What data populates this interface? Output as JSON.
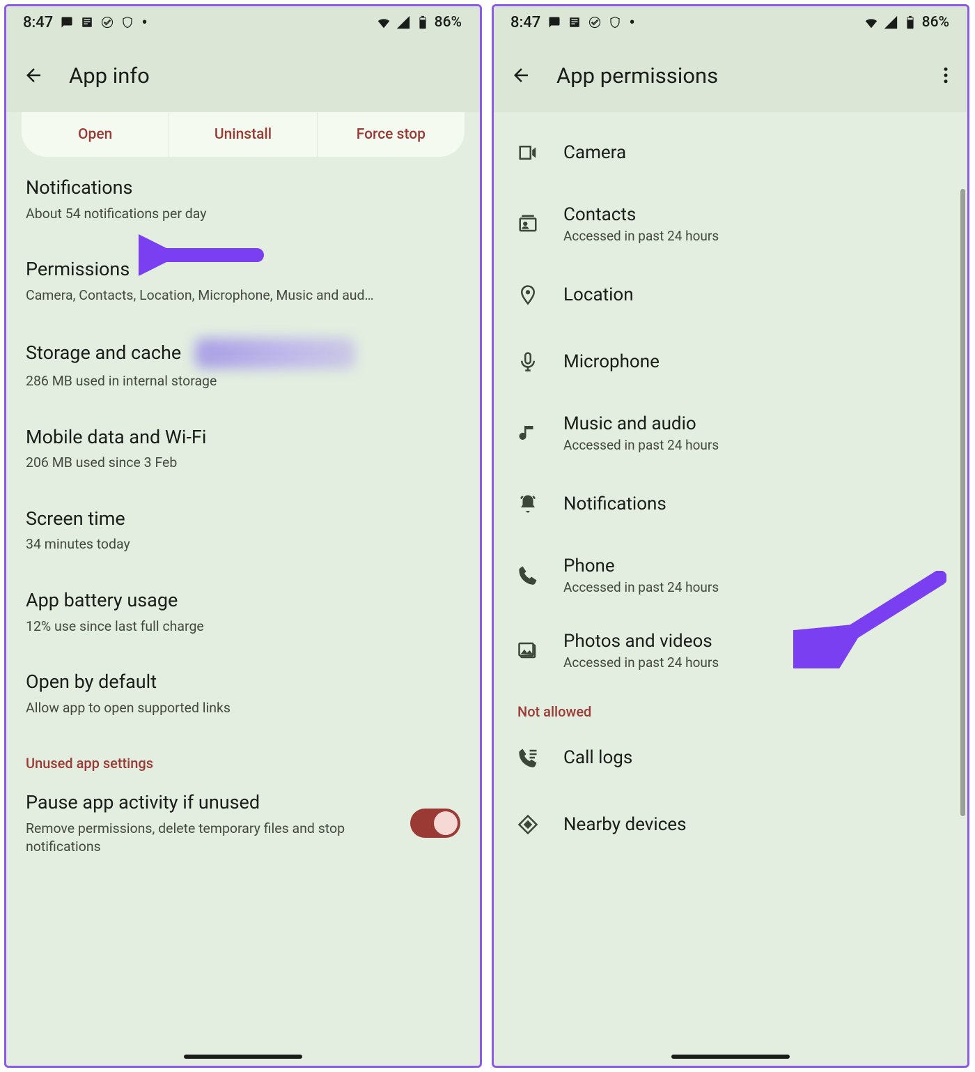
{
  "status": {
    "time": "8:47",
    "battery": "86%"
  },
  "left": {
    "title": "App info",
    "actions": {
      "open": "Open",
      "uninstall": "Uninstall",
      "force": "Force stop"
    },
    "notifications": {
      "title": "Notifications",
      "sub": "About 54 notifications per day"
    },
    "permissions": {
      "title": "Permissions",
      "sub": "Camera, Contacts, Location, Microphone, Music and aud…"
    },
    "storage": {
      "title": "Storage and cache",
      "sub": "286 MB used in internal storage"
    },
    "mobile": {
      "title": "Mobile data and Wi-Fi",
      "sub": "206 MB used since 3 Feb"
    },
    "screen": {
      "title": "Screen time",
      "sub": "34 minutes today"
    },
    "battery": {
      "title": "App battery usage",
      "sub": "12% use since last full charge"
    },
    "openby": {
      "title": "Open by default",
      "sub": "Allow app to open supported links"
    },
    "unused_header": "Unused app settings",
    "pause": {
      "title": "Pause app activity if unused",
      "sub": "Remove permissions, delete temporary files and stop notifications"
    }
  },
  "right": {
    "title": "App permissions",
    "accessed": "Accessed in past 24 hours",
    "notallowed": "Not allowed",
    "items": {
      "camera": "Camera",
      "contacts": "Contacts",
      "location": "Location",
      "microphone": "Microphone",
      "music": "Music and audio",
      "notifications": "Notifications",
      "phone": "Phone",
      "photos": "Photos and videos",
      "calllogs": "Call logs",
      "nearby": "Nearby devices"
    }
  }
}
